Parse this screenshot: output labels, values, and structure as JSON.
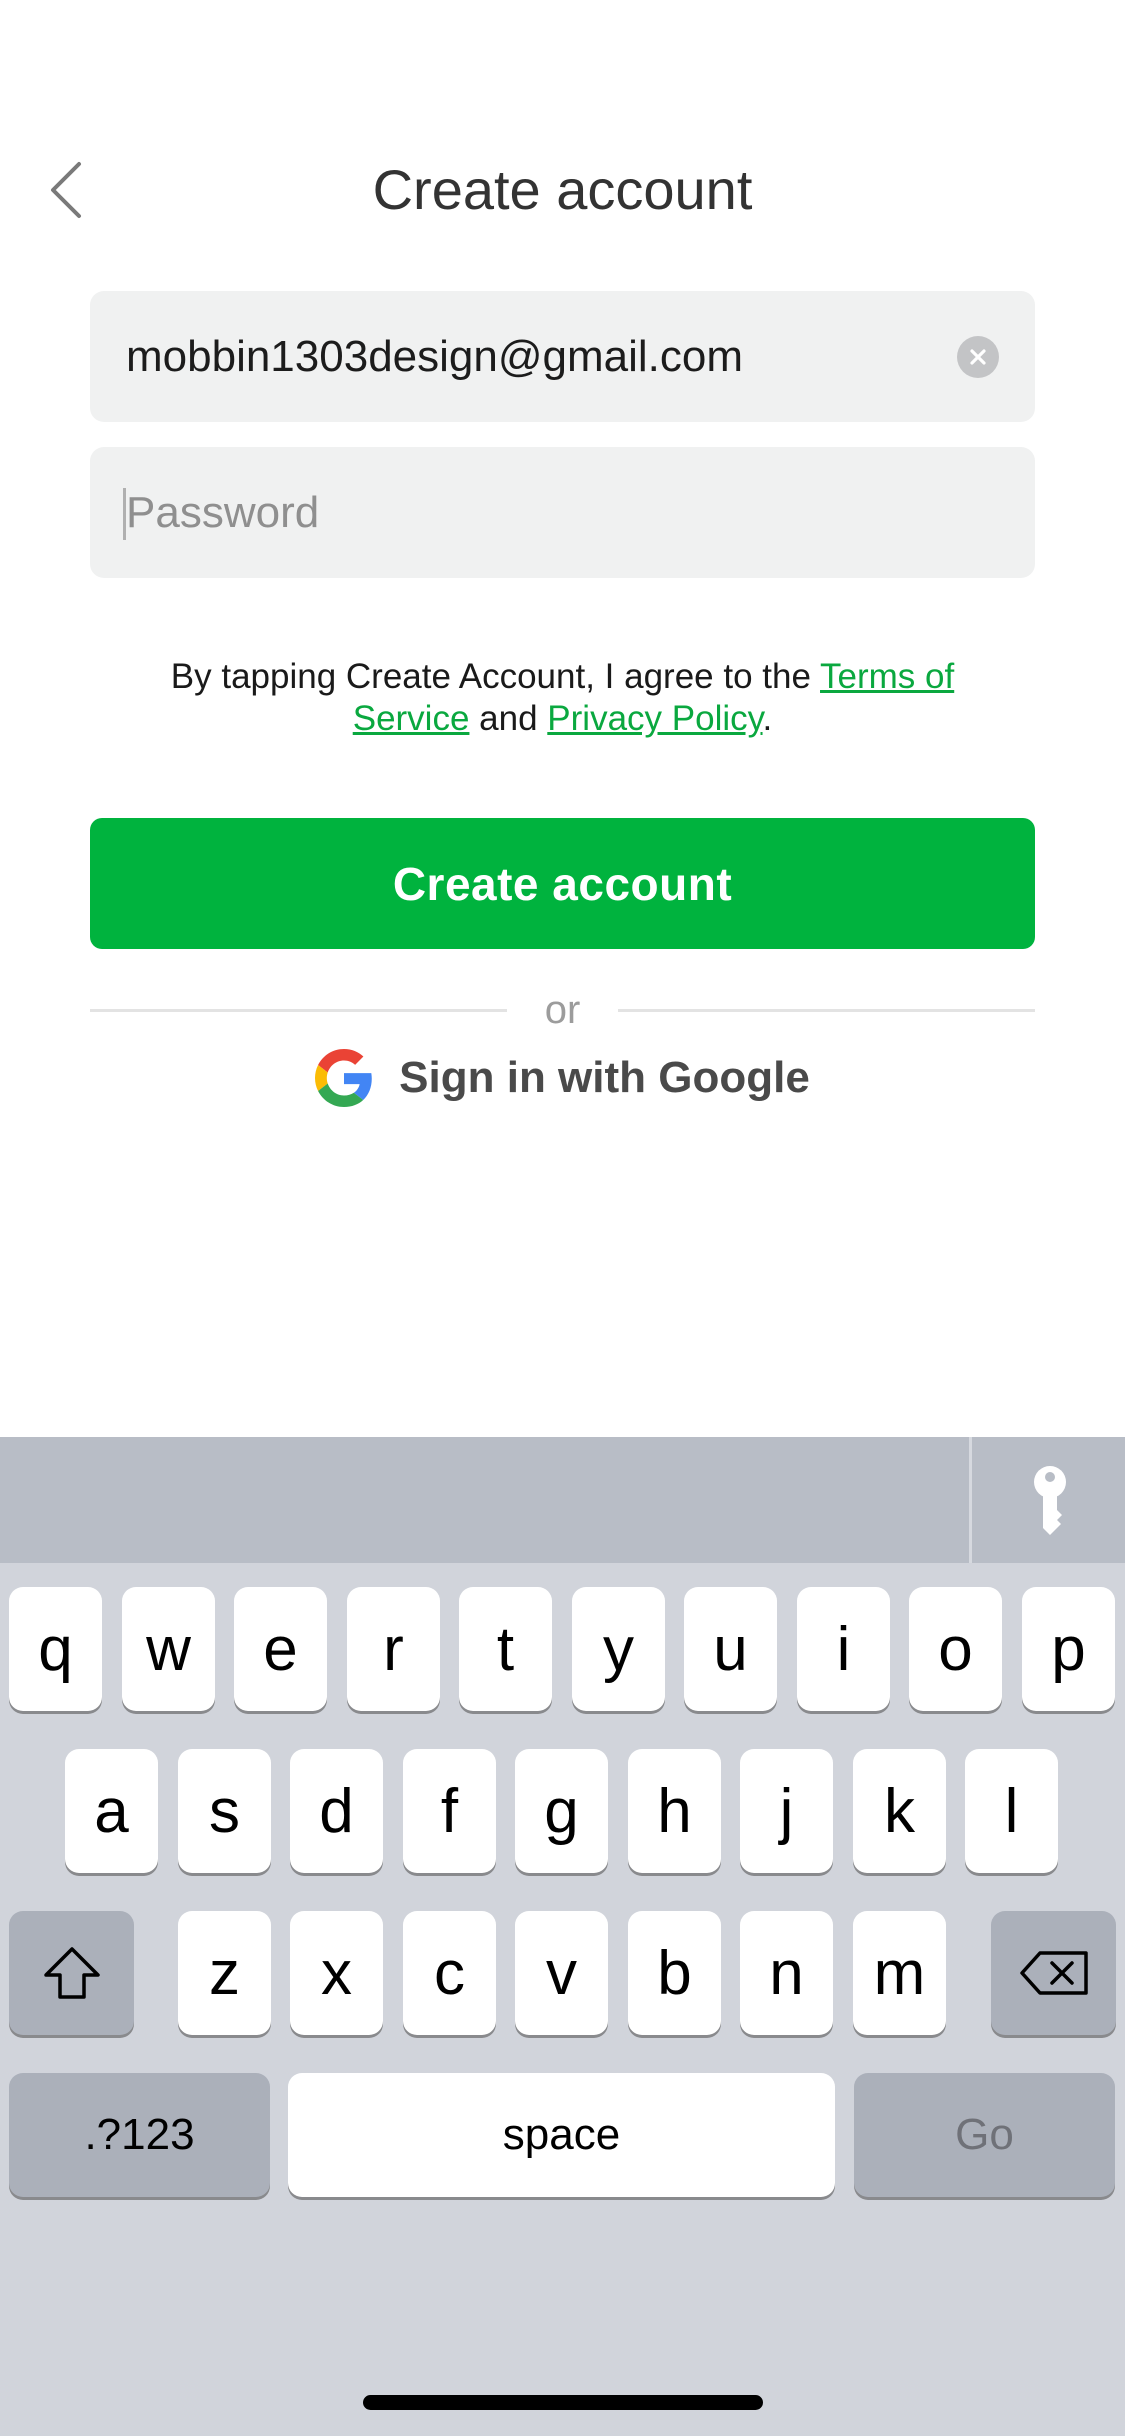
{
  "header": {
    "title": "Create account"
  },
  "form": {
    "email_value": "mobbin1303design@gmail.com",
    "password_placeholder": "Password"
  },
  "terms": {
    "prefix": "By tapping Create Account, I agree to the ",
    "terms_link": "Terms of Service",
    "middle": " and ",
    "privacy_link": "Privacy Policy",
    "suffix": "."
  },
  "actions": {
    "create_account_label": "Create account",
    "divider_text": "or",
    "google_label": "Sign in with Google"
  },
  "keyboard": {
    "row1": [
      "q",
      "w",
      "e",
      "r",
      "t",
      "y",
      "u",
      "i",
      "o",
      "p"
    ],
    "row2": [
      "a",
      "s",
      "d",
      "f",
      "g",
      "h",
      "j",
      "k",
      "l"
    ],
    "row3": [
      "z",
      "x",
      "c",
      "v",
      "b",
      "n",
      "m"
    ],
    "numbers_label": ".?123",
    "space_label": "space",
    "go_label": "Go"
  },
  "colors": {
    "brand_green": "#00b33e",
    "link_green": "#0aa83f",
    "field_bg": "#f0f1f1",
    "keyboard_bg": "#d1d4db"
  }
}
